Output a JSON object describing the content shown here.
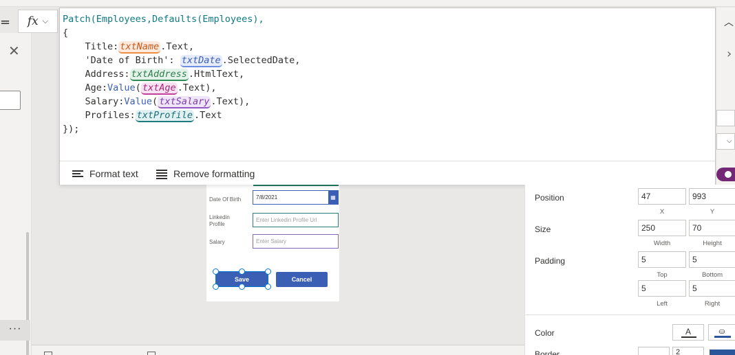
{
  "formula_bar": {
    "equals": "=",
    "fx_label": "fx",
    "chevron": "⌵"
  },
  "code": {
    "line1_fn": "Patch",
    "line1_args": "(Employees,",
    "line1_fn2": "Defaults",
    "line1_args2": "(Employees),",
    "open_brace": "{",
    "title_key": "    Title:",
    "title_ctrl": "txtName",
    "title_rest": ".Text,",
    "dob_key": "    'Date of Birth': ",
    "dob_ctrl": "txtDate",
    "dob_rest": ".SelectedDate,",
    "addr_key": "    Address:",
    "addr_ctrl": "txtAddress",
    "addr_rest": ".HtmlText,",
    "age_key": "    Age:",
    "age_fn": "Value",
    "age_open": "(",
    "age_ctrl": "txtAge",
    "age_rest": ".Text),",
    "sal_key": "    Salary:",
    "sal_fn": "Value",
    "sal_open": "(",
    "sal_ctrl": "txtSalary",
    "sal_rest": ".Text),",
    "prof_key": "    Profiles:",
    "prof_ctrl": "txtProfile",
    "prof_rest": ".Text",
    "close": "});"
  },
  "editor_footer": {
    "format_text": "Format text",
    "remove_formatting": "Remove formatting"
  },
  "left_panel": {
    "close": "✕",
    "more": "···"
  },
  "form": {
    "dob_label": "Date Of Birth",
    "dob_value": "7/8/2021",
    "calendar_icon": "▦",
    "linkedin_label_1": "Linkedin",
    "linkedin_label_2": "Profile",
    "linkedin_placeholder": "Enter Linkedin Profile Url",
    "salary_label": "Salary",
    "salary_placeholder": "Enter Salary",
    "save": "Save",
    "cancel": "Cancel"
  },
  "right_strip": {
    "up_chevron": "︿",
    "right_chevron": "›",
    "select_chevron": "⌵"
  },
  "properties": {
    "position_label": "Position",
    "position_x": "47",
    "position_y": "993",
    "x_caption": "X",
    "y_caption": "Y",
    "size_label": "Size",
    "width": "250",
    "height": "70",
    "width_caption": "Width",
    "height_caption": "Height",
    "padding_label": "Padding",
    "pad_top": "5",
    "pad_bottom": "5",
    "pad_left": "5",
    "pad_right": "5",
    "top_caption": "Top",
    "bottom_caption": "Bottom",
    "left_caption": "Left",
    "right_caption": "Right",
    "color_label": "Color",
    "color_text_icon": "A",
    "color_fill_icon": "⛀",
    "border_label": "Border",
    "border_width": "2"
  }
}
